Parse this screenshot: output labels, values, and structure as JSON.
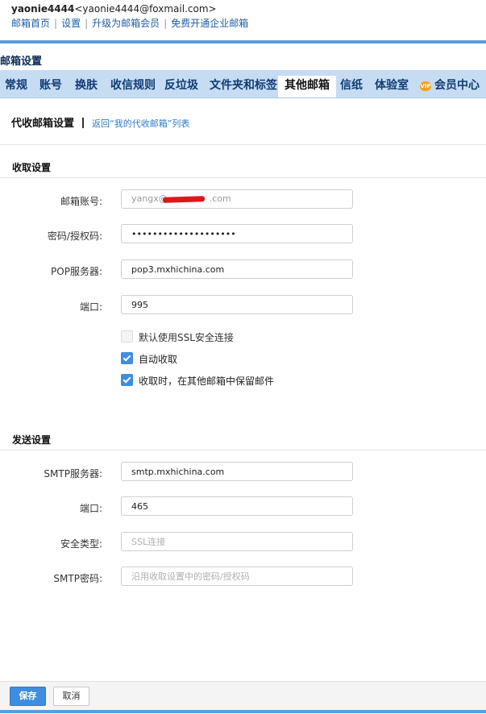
{
  "header": {
    "username": "yaonie4444",
    "email": "<yaonie4444@foxmail.com>",
    "links": [
      "邮箱首页",
      "设置",
      "升级为邮箱会员",
      "免费开通企业邮箱"
    ]
  },
  "page_title": "邮箱设置",
  "tabs": [
    "常规",
    "账号",
    "换肤",
    "收信规则",
    "反垃圾",
    "文件夹和标签",
    "其他邮箱",
    "信纸",
    "体验室",
    "会员中心"
  ],
  "active_tab": "其他邮箱",
  "vip_badge": "VIP",
  "subheader": {
    "title": "代收邮箱设置",
    "back_link": "返回“我的代收邮箱”列表"
  },
  "receive": {
    "section_title": "收取设置",
    "account_label": "邮箱账号:",
    "account_value_prefix": "yangx@",
    "account_value_suffix": ".com",
    "password_label": "密码/授权码:",
    "password_value": "••••••••••••••••••••",
    "pop_label": "POP服务器:",
    "pop_value": "pop3.mxhichina.com",
    "port_label": "端口:",
    "port_value": "995",
    "checkboxes": [
      {
        "label": "默认使用SSL安全连接",
        "checked": false
      },
      {
        "label": "自动收取",
        "checked": true
      },
      {
        "label": "收取时，在其他邮箱中保留邮件",
        "checked": true
      }
    ]
  },
  "send": {
    "section_title": "发送设置",
    "smtp_label": "SMTP服务器:",
    "smtp_value": "smtp.mxhichina.com",
    "port_label": "端口:",
    "port_value": "465",
    "security_label": "安全类型:",
    "security_placeholder": "SSL连接",
    "smtp_password_label": "SMTP密码:",
    "smtp_password_placeholder": "沿用收取设置中的密码/授权码"
  },
  "footer": {
    "save_label": "保存",
    "cancel_label": "取消"
  },
  "colors": {
    "accent": "#3d8ee0",
    "tab_bar": "#c6dcf3",
    "link": "#1f5fa6",
    "redaction": "#e0161d"
  }
}
